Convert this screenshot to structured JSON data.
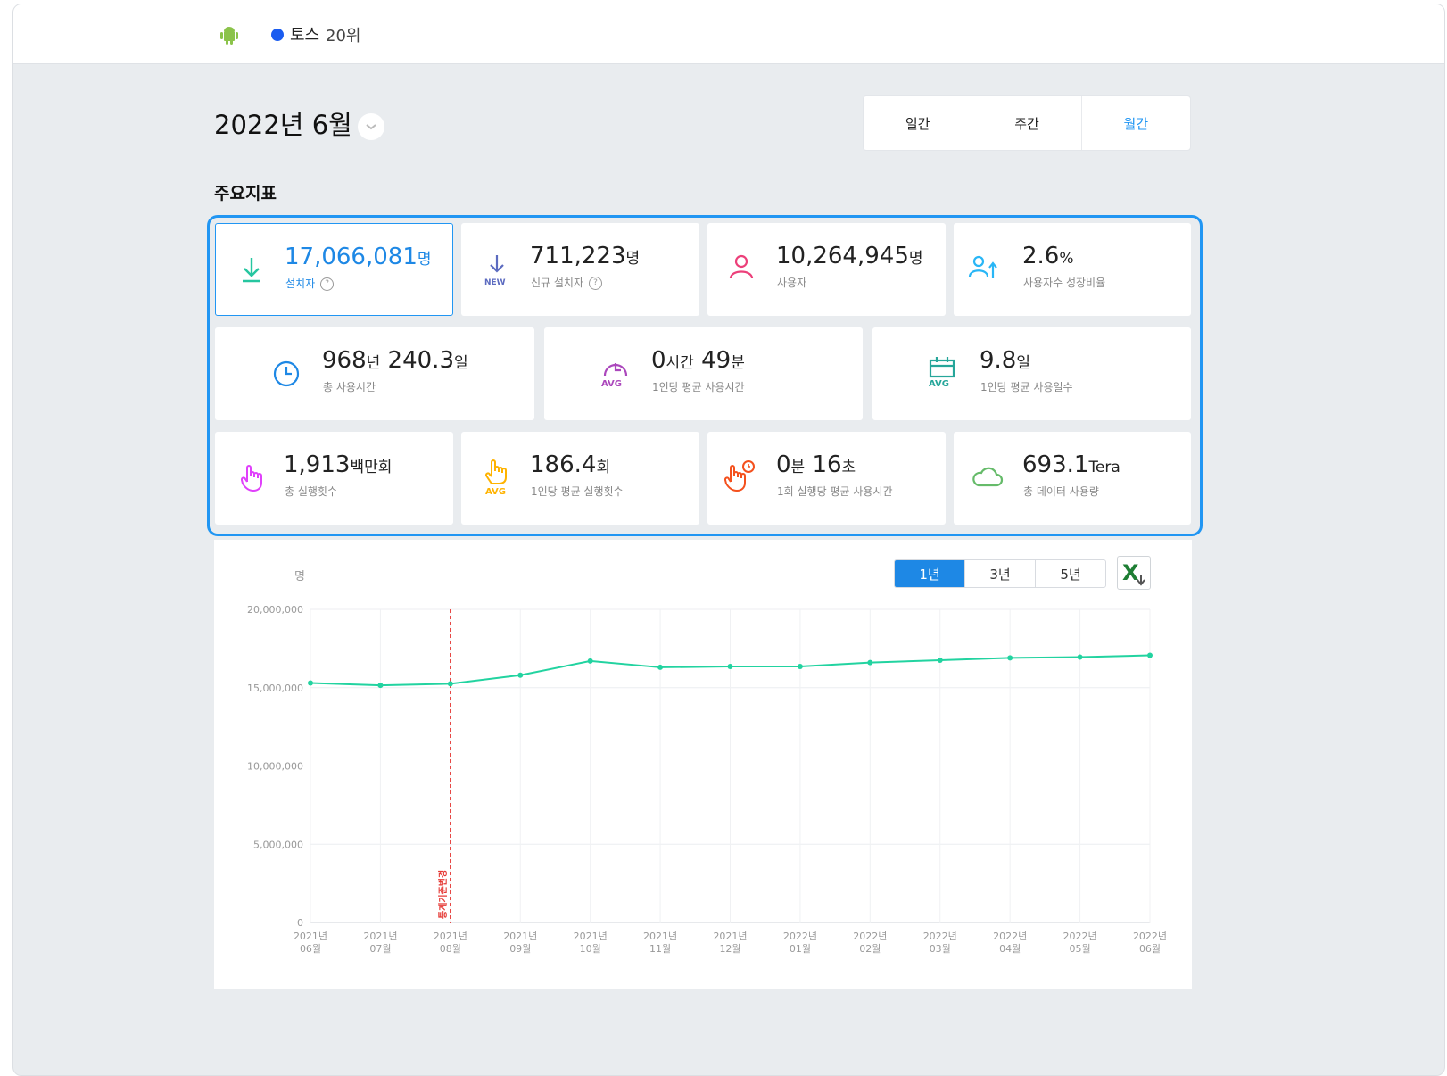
{
  "header": {
    "app_name": "토스",
    "rank": "20위",
    "platform_icon": "android-icon",
    "app_icon_color": "#1a5cf0"
  },
  "date": {
    "title": "2022년 6월"
  },
  "period_tabs": [
    {
      "label": "일간",
      "active": false
    },
    {
      "label": "주간",
      "active": false
    },
    {
      "label": "월간",
      "active": true
    }
  ],
  "section_title": "주요지표",
  "kpis": {
    "installers": {
      "value": "17,066,081",
      "unit": "명",
      "label": "설치자"
    },
    "new_installers": {
      "value": "711,223",
      "unit": "명",
      "label": "신규 설치자",
      "badge": "NEW"
    },
    "users": {
      "value": "10,264,945",
      "unit": "명",
      "label": "사용자"
    },
    "growth": {
      "value": "2.6",
      "unit": "%",
      "label": "사용자수 성장비율"
    },
    "total_time": {
      "value1": "968",
      "unit1": "년",
      "value2": "240.3",
      "unit2": "일",
      "label": "총 사용시간"
    },
    "avg_time": {
      "value1": "0",
      "unit1": "시간",
      "value2": "49",
      "unit2": "분",
      "label": "1인당 평균 사용시간",
      "badge": "AVG"
    },
    "avg_days": {
      "value": "9.8",
      "unit": "일",
      "label": "1인당 평균 사용일수",
      "badge": "AVG"
    },
    "total_runs": {
      "value": "1,913",
      "unit": "백만회",
      "label": "총 실행횟수"
    },
    "avg_runs": {
      "value": "186.4",
      "unit": "회",
      "label": "1인당 평균 실행횟수",
      "badge": "AVG"
    },
    "time_per_run": {
      "value1": "0",
      "unit1": "분",
      "value2": "16",
      "unit2": "초",
      "label": "1회 실행당 평균 사용시간"
    },
    "data_usage": {
      "value": "693.1",
      "unit": "Tera",
      "label": "총 데이터 사용량"
    }
  },
  "chart_controls": {
    "range_tabs": [
      {
        "label": "1년",
        "active": true
      },
      {
        "label": "3년",
        "active": false
      },
      {
        "label": "5년",
        "active": false
      }
    ],
    "export_icon": "excel-download-icon"
  },
  "colors": {
    "accent": "#1e88e5",
    "line": "#22d3a0",
    "marker": "#e53935"
  },
  "chart_data": {
    "type": "line",
    "ylabel": "명",
    "ylim": [
      0,
      20000000
    ],
    "yticks": [
      "0",
      "5,000,000",
      "10,000,000",
      "15,000,000",
      "20,000,000"
    ],
    "yticks_values": [
      0,
      5000000,
      10000000,
      15000000,
      20000000
    ],
    "categories": [
      [
        "2021년",
        "06월"
      ],
      [
        "2021년",
        "07월"
      ],
      [
        "2021년",
        "08월"
      ],
      [
        "2021년",
        "09월"
      ],
      [
        "2021년",
        "10월"
      ],
      [
        "2021년",
        "11월"
      ],
      [
        "2021년",
        "12월"
      ],
      [
        "2022년",
        "01월"
      ],
      [
        "2022년",
        "02월"
      ],
      [
        "2022년",
        "03월"
      ],
      [
        "2022년",
        "04월"
      ],
      [
        "2022년",
        "05월"
      ],
      [
        "2022년",
        "06월"
      ]
    ],
    "series": [
      {
        "values": [
          15300000,
          15150000,
          15250000,
          15800000,
          16700000,
          16300000,
          16350000,
          16350000,
          16600000,
          16750000,
          16900000,
          16950000,
          17066081
        ]
      }
    ],
    "annotation": {
      "category_index": 2,
      "label": "통계기준변경"
    }
  }
}
